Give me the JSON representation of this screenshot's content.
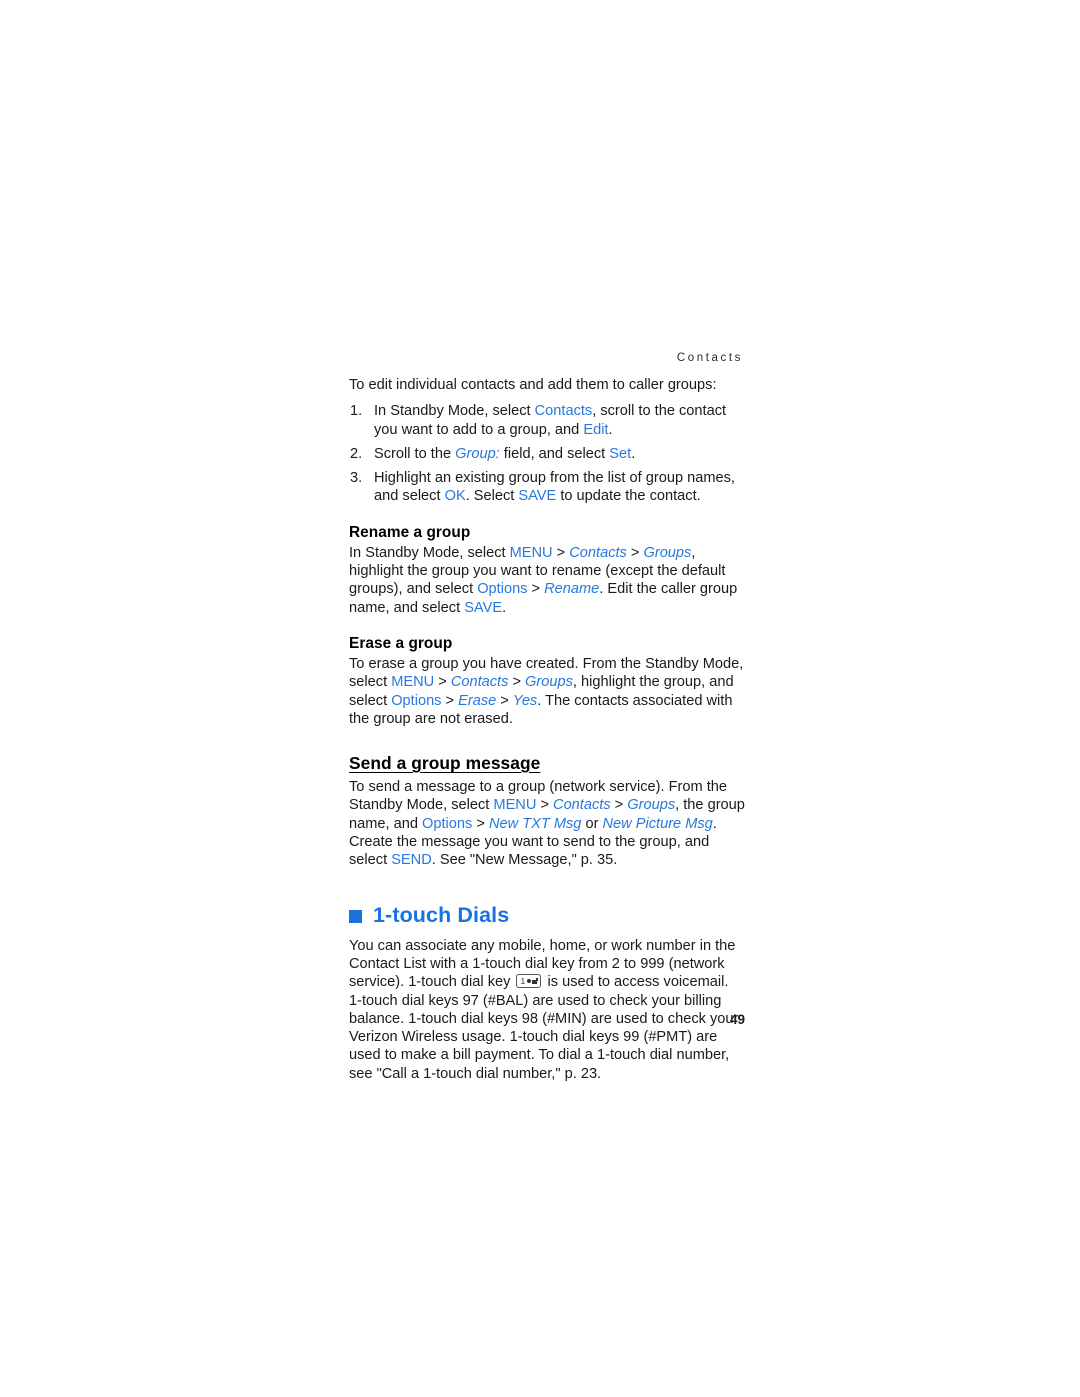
{
  "document": {
    "running_header": "Contacts",
    "page_number": "49"
  },
  "intro": {
    "lead": "To edit individual contacts and add them to caller groups:",
    "steps": [
      {
        "num": "1.",
        "parts": [
          {
            "t": "In Standby Mode, select ",
            "s": "plain"
          },
          {
            "t": "Contacts",
            "s": "ui"
          },
          {
            "t": ", scroll to the contact you want to add to a group, and ",
            "s": "plain"
          },
          {
            "t": "Edit",
            "s": "ui"
          },
          {
            "t": ".",
            "s": "plain"
          }
        ]
      },
      {
        "num": "2.",
        "parts": [
          {
            "t": "Scroll to the ",
            "s": "plain"
          },
          {
            "t": "Group:",
            "s": "ui-i"
          },
          {
            "t": " field, and select ",
            "s": "plain"
          },
          {
            "t": "Set",
            "s": "ui"
          },
          {
            "t": ".",
            "s": "plain"
          }
        ]
      },
      {
        "num": "3.",
        "parts": [
          {
            "t": "Highlight an existing group from the list of group names, and select ",
            "s": "plain"
          },
          {
            "t": "OK",
            "s": "ui"
          },
          {
            "t": ". Select ",
            "s": "plain"
          },
          {
            "t": "SAVE",
            "s": "ui"
          },
          {
            "t": " to update the contact.",
            "s": "plain"
          }
        ]
      }
    ]
  },
  "rename_group": {
    "heading": "Rename a group",
    "parts": [
      {
        "t": "In Standby Mode, select ",
        "s": "plain"
      },
      {
        "t": "MENU",
        "s": "ui"
      },
      {
        "t": " > ",
        "s": "plain"
      },
      {
        "t": "Contacts",
        "s": "ui-i"
      },
      {
        "t": " > ",
        "s": "plain"
      },
      {
        "t": "Groups",
        "s": "ui-i"
      },
      {
        "t": ", highlight the group you want to rename (except the default groups), and select ",
        "s": "plain"
      },
      {
        "t": "Options",
        "s": "ui"
      },
      {
        "t": " > ",
        "s": "plain"
      },
      {
        "t": "Rename",
        "s": "ui-i"
      },
      {
        "t": ". Edit the caller group name, and select ",
        "s": "plain"
      },
      {
        "t": "SAVE",
        "s": "ui"
      },
      {
        "t": ".",
        "s": "plain"
      }
    ]
  },
  "erase_group": {
    "heading": "Erase a group",
    "parts": [
      {
        "t": "To erase a group you have created. From the Standby Mode, select ",
        "s": "plain"
      },
      {
        "t": "MENU",
        "s": "ui"
      },
      {
        "t": " > ",
        "s": "plain"
      },
      {
        "t": "Contacts",
        "s": "ui-i"
      },
      {
        "t": " > ",
        "s": "plain"
      },
      {
        "t": "Groups",
        "s": "ui-i"
      },
      {
        "t": ", highlight the group, and select ",
        "s": "plain"
      },
      {
        "t": "Options",
        "s": "ui"
      },
      {
        "t": " > ",
        "s": "plain"
      },
      {
        "t": "Erase",
        "s": "ui-i"
      },
      {
        "t": " > ",
        "s": "plain"
      },
      {
        "t": "Yes",
        "s": "ui-i"
      },
      {
        "t": ". The contacts associated with the group are not erased.",
        "s": "plain"
      }
    ]
  },
  "send_group_message": {
    "heading": "Send a group message",
    "parts": [
      {
        "t": "To send a message to a group (network service). From the Standby Mode,  select ",
        "s": "plain"
      },
      {
        "t": "MENU",
        "s": "ui"
      },
      {
        "t": " > ",
        "s": "plain"
      },
      {
        "t": "Contacts",
        "s": "ui-i"
      },
      {
        "t": " > ",
        "s": "plain"
      },
      {
        "t": "Groups",
        "s": "ui-i"
      },
      {
        "t": ", the group name, and ",
        "s": "plain"
      },
      {
        "t": "Options",
        "s": "ui"
      },
      {
        "t": " > ",
        "s": "plain"
      },
      {
        "t": "New TXT Msg",
        "s": "ui-i"
      },
      {
        "t": " or ",
        "s": "plain"
      },
      {
        "t": "New Picture Msg",
        "s": "ui-i"
      },
      {
        "t": ". Create the message you want to send to the group, and select ",
        "s": "plain"
      },
      {
        "t": "SEND",
        "s": "ui"
      },
      {
        "t": ". See \"New Message,\" p. 35.",
        "s": "plain"
      }
    ]
  },
  "one_touch_dials": {
    "heading": "1-touch Dials",
    "bullet_icon": "square-bullet-icon",
    "parts_before_key": [
      {
        "t": "You can associate any mobile, home, or work number in the Contact List with a 1-touch dial key from 2 to 999 (network service). 1-touch dial key ",
        "s": "plain"
      }
    ],
    "key_icon_name": "voicemail-key-icon",
    "key_icon_label": "1",
    "parts_after_key": [
      {
        "t": " is used to access voicemail. 1-touch dial keys 97 (#BAL) are used to check your billing balance. 1-touch dial keys 98 (#MIN) are used to check your Verizon Wireless usage. 1-touch dial keys 99 (#PMT) are used to make a bill payment. To dial a 1-touch dial number, see \"Call a 1-touch dial number,\" p. 23.",
        "s": "plain"
      }
    ]
  },
  "colors": {
    "ui_blue": "#2878dc",
    "heading_blue": "#1a72e0",
    "body_black": "#1a1a1a",
    "page_background": "#ffffff"
  }
}
